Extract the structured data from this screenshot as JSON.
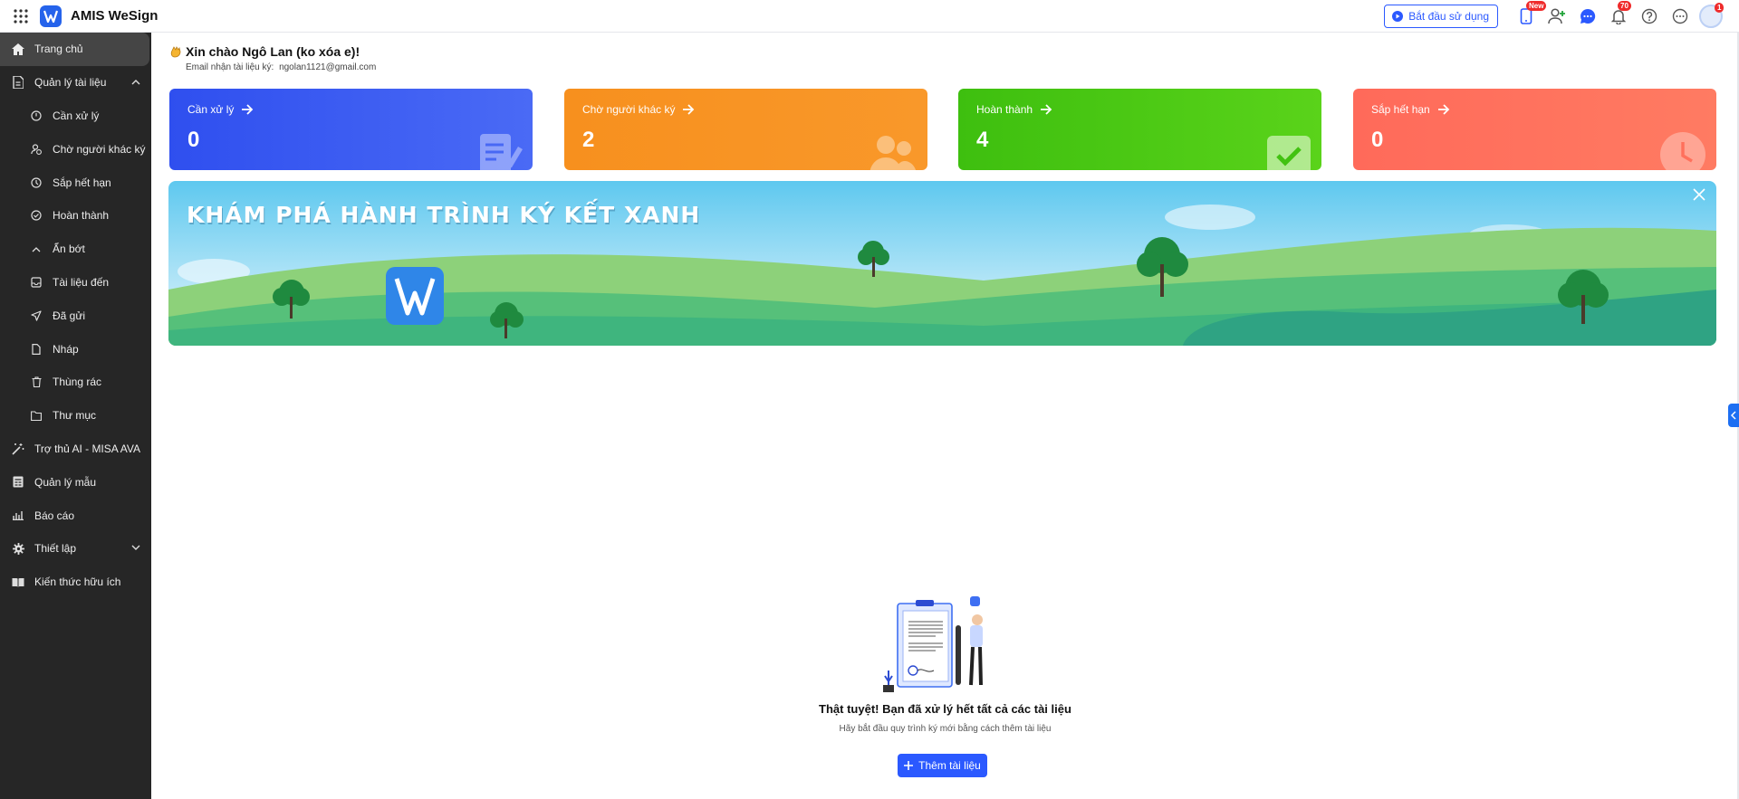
{
  "app": {
    "title": "AMIS WeSign"
  },
  "header": {
    "start_label": "Bắt đầu sử dụng",
    "new_badge": "New",
    "notif_count": "70",
    "avatar_badge": "1"
  },
  "sidebar": {
    "items": [
      {
        "label": "Trang chủ"
      },
      {
        "label": "Quản lý tài liệu"
      },
      {
        "label": "Cần xử lý"
      },
      {
        "label": "Chờ người khác ký"
      },
      {
        "label": "Sắp hết hạn"
      },
      {
        "label": "Hoàn thành"
      },
      {
        "label": "Ẩn bớt"
      },
      {
        "label": "Tài liệu đến"
      },
      {
        "label": "Đã gửi"
      },
      {
        "label": "Nháp"
      },
      {
        "label": "Thùng rác"
      },
      {
        "label": "Thư mục"
      },
      {
        "label": "Trợ thủ AI - MISA AVA"
      },
      {
        "label": "Quản lý mẫu"
      },
      {
        "label": "Báo cáo"
      },
      {
        "label": "Thiết lập"
      },
      {
        "label": "Kiến thức hữu ích"
      }
    ]
  },
  "main": {
    "greeting": "Xin chào Ngô Lan (ko xóa e)!",
    "email_label": "Email nhận tài liệu ký:",
    "email": "ngolan1121@gmail.com",
    "cards": [
      {
        "title": "Cần xử lý",
        "value": "0",
        "color": "#2f4fef"
      },
      {
        "title": "Chờ người khác ký",
        "value": "2",
        "color": "#f7901e"
      },
      {
        "title": "Hoàn thành",
        "value": "4",
        "color": "#4fcb14"
      },
      {
        "title": "Sắp hết hạn",
        "value": "0",
        "color": "#ff6a5a"
      }
    ],
    "banner_title": "KHÁM PHÁ HÀNH TRÌNH KÝ KẾT XANH",
    "empty_title": "Thật tuyệt! Bạn đã xử lý hết tất cả các tài liệu",
    "empty_subtitle": "Hãy bắt đầu quy trình ký mới bằng cách thêm tài liệu",
    "add_label": "Thêm tài liệu"
  }
}
